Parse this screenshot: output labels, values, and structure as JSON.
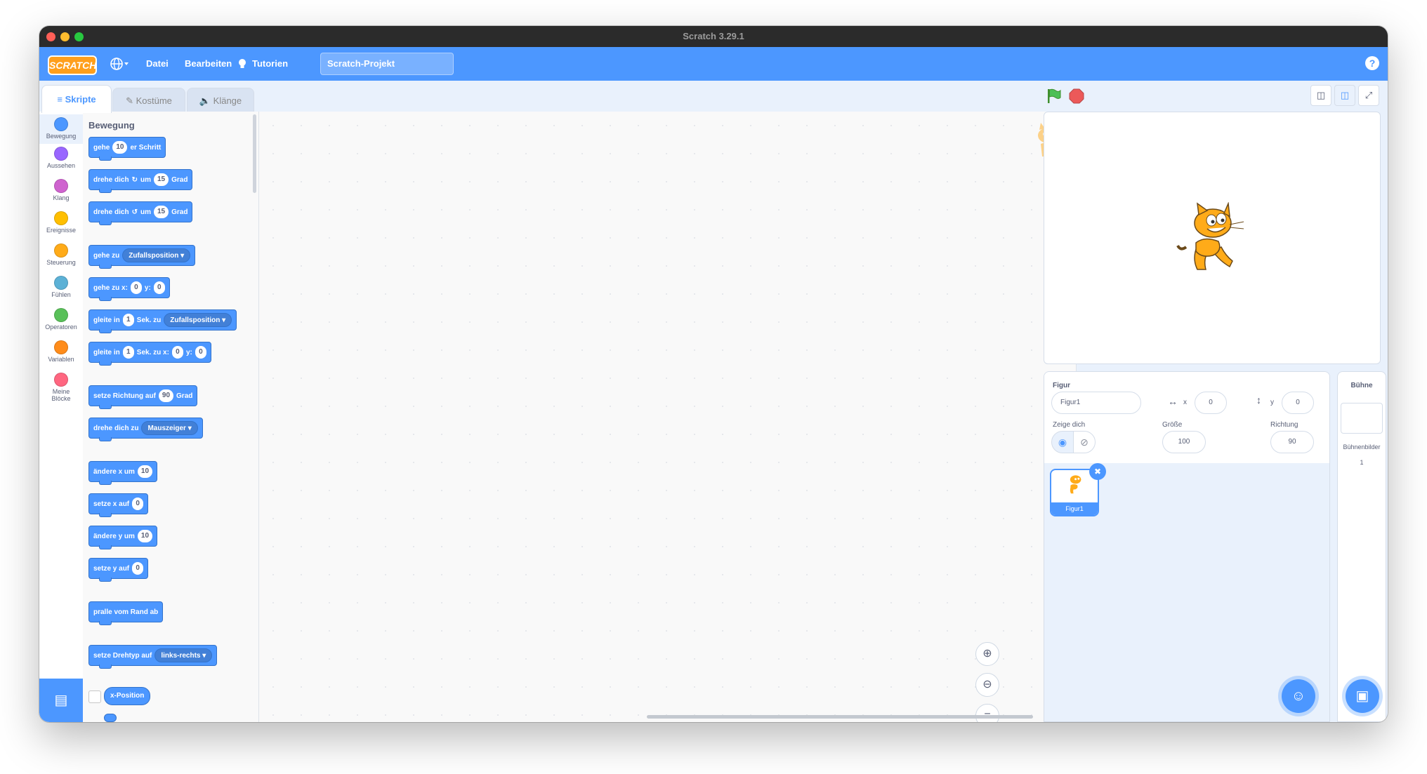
{
  "window": {
    "title": "Scratch 3.29.1"
  },
  "menu": {
    "logo": "SCRATCH",
    "language_icon": "globe-icon",
    "file": "Datei",
    "edit": "Bearbeiten",
    "tutorials": "Tutorien",
    "project_name": "Scratch-Projekt",
    "help": "?"
  },
  "tabs": {
    "scripts": "Skripte",
    "costumes": "Kostüme",
    "sounds": "Klänge"
  },
  "categories": [
    {
      "label": "Bewegung",
      "color": "#4c97ff"
    },
    {
      "label": "Aussehen",
      "color": "#9966ff"
    },
    {
      "label": "Klang",
      "color": "#cf63cf"
    },
    {
      "label": "Ereignisse",
      "color": "#ffbf00"
    },
    {
      "label": "Steuerung",
      "color": "#ffab19"
    },
    {
      "label": "Fühlen",
      "color": "#5cb1d6"
    },
    {
      "label": "Operatoren",
      "color": "#59c059"
    },
    {
      "label": "Variablen",
      "color": "#ff8c1a"
    },
    {
      "label": "Meine Blöcke",
      "color": "#ff6680"
    }
  ],
  "palette": {
    "title": "Bewegung",
    "b1": {
      "a": "gehe",
      "v": "10",
      "b": "er Schritt"
    },
    "b2": {
      "a": "drehe dich",
      "b": "um",
      "v": "15",
      "c": "Grad"
    },
    "b3": {
      "a": "drehe dich",
      "b": "um",
      "v": "15",
      "c": "Grad"
    },
    "b4": {
      "a": "gehe zu",
      "d": "Zufallsposition"
    },
    "b5": {
      "a": "gehe zu x:",
      "x": "0",
      "b": "y:",
      "y": "0"
    },
    "b6": {
      "a": "gleite in",
      "v": "1",
      "b": "Sek. zu",
      "d": "Zufallsposition"
    },
    "b7": {
      "a": "gleite in",
      "v": "1",
      "b": "Sek. zu x:",
      "x": "0",
      "c": "y:",
      "y": "0"
    },
    "b8": {
      "a": "setze Richtung auf",
      "v": "90",
      "b": "Grad"
    },
    "b9": {
      "a": "drehe dich zu",
      "d": "Mauszeiger"
    },
    "b10": {
      "a": "ändere x um",
      "v": "10"
    },
    "b11": {
      "a": "setze x auf",
      "v": "0"
    },
    "b12": {
      "a": "ändere y um",
      "v": "10"
    },
    "b13": {
      "a": "setze y auf",
      "v": "0"
    },
    "b14": {
      "a": "pralle vom Rand ab"
    },
    "b15": {
      "a": "setze Drehtyp auf",
      "d": "links-rechts"
    },
    "r1": "x-Position"
  },
  "sprite_info": {
    "sprite_label": "Figur",
    "sprite_name": "Figur1",
    "x_label": "x",
    "x_value": "0",
    "y_label": "y",
    "y_value": "0",
    "show_label": "Zeige dich",
    "size_label": "Größe",
    "size_value": "100",
    "direction_label": "Richtung",
    "direction_value": "90"
  },
  "sprite_list": [
    {
      "name": "Figur1"
    }
  ],
  "stage_pane": {
    "title": "Bühne",
    "backdrops_label": "Bühnenbilder",
    "backdrops_count": "1"
  }
}
